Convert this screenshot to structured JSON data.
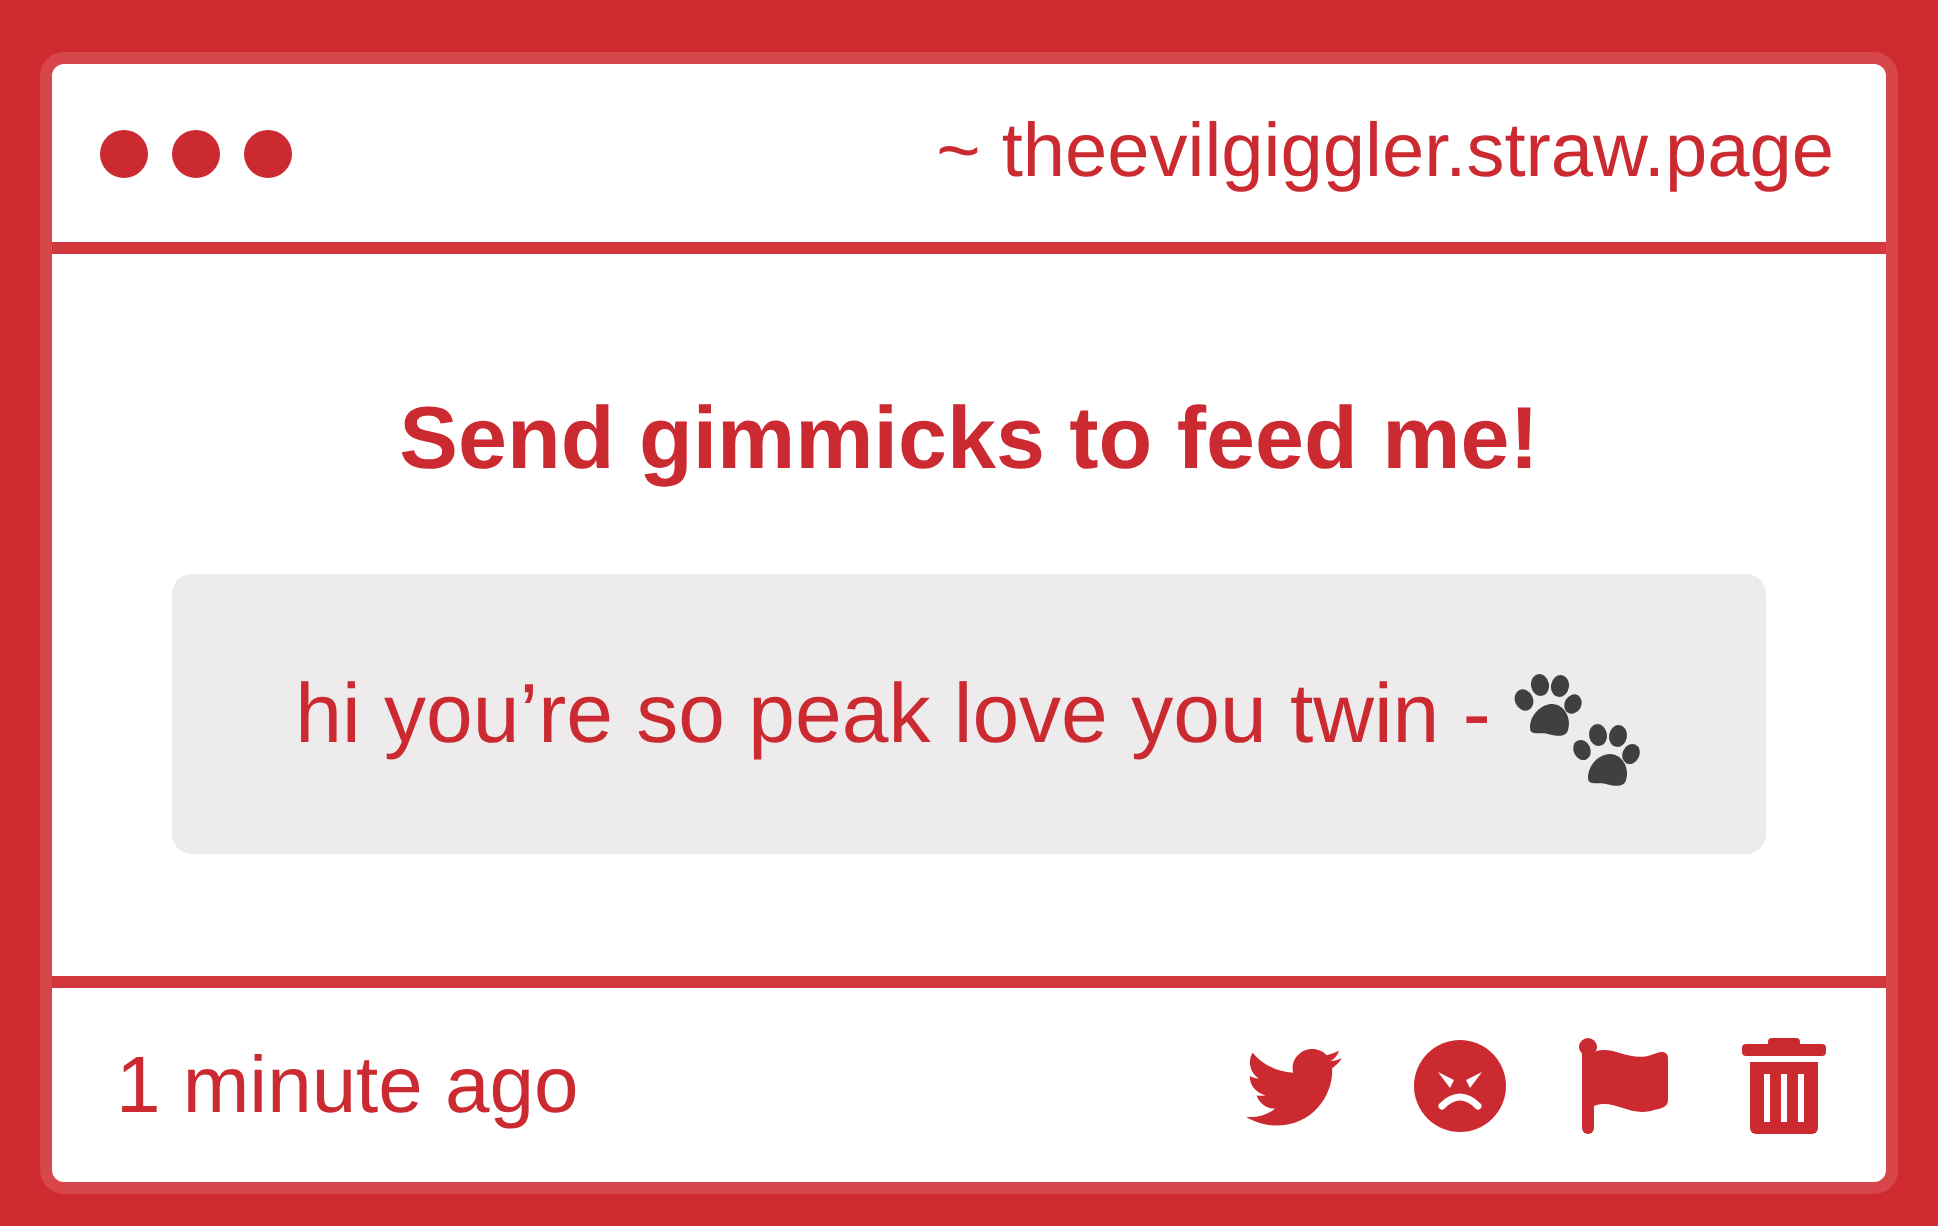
{
  "header": {
    "url": "~ theevilgiggler.straw.page"
  },
  "prompt": "Send gimmicks to feed me!",
  "message": {
    "text": "hi you’re so peak love you twin -"
  },
  "footer": {
    "time": "1 minute ago"
  }
}
